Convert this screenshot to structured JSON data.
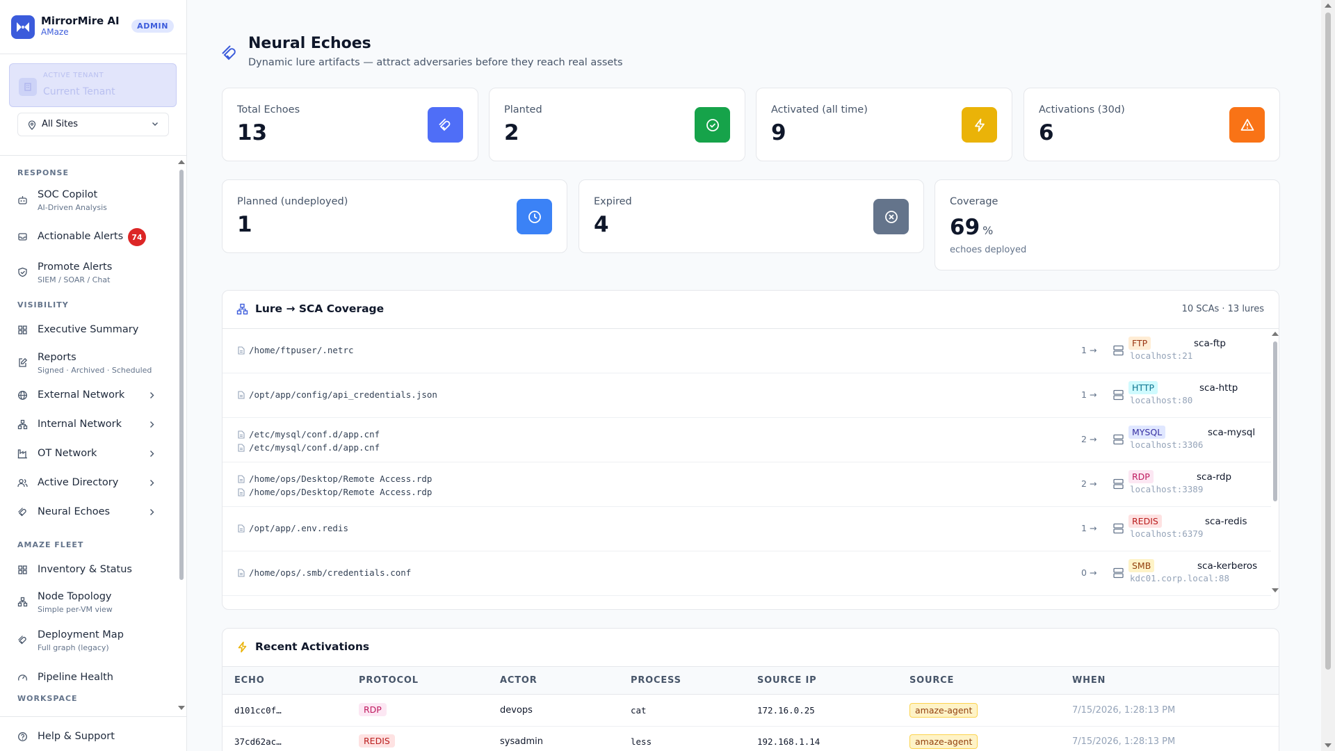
{
  "brand": {
    "name": "MirrorMire AI",
    "sub": "AMaze",
    "badge": "ADMIN"
  },
  "tenant": {
    "label": "ACTIVE TENANT",
    "name": "Current Tenant"
  },
  "site_select": {
    "value": "All Sites"
  },
  "nav": {
    "sections": {
      "response": "RESPONSE",
      "visibility": "VISIBILITY",
      "fleet": "AMAZE FLEET",
      "workspace": "WORKSPACE"
    },
    "soc_copilot": {
      "label": "SOC Copilot",
      "sub": "AI-Driven Analysis"
    },
    "actionable_alerts": {
      "label": "Actionable Alerts",
      "badge": "74"
    },
    "promote_alerts": {
      "label": "Promote Alerts",
      "sub": "SIEM / SOAR / Chat"
    },
    "executive_summary": {
      "label": "Executive Summary"
    },
    "reports": {
      "label": "Reports",
      "sub": "Signed · Archived · Scheduled"
    },
    "external_network": {
      "label": "External Network"
    },
    "internal_network": {
      "label": "Internal Network"
    },
    "ot_network": {
      "label": "OT Network"
    },
    "active_directory": {
      "label": "Active Directory"
    },
    "neural_echoes": {
      "label": "Neural Echoes"
    },
    "inventory": {
      "label": "Inventory & Status"
    },
    "node_topology": {
      "label": "Node Topology",
      "sub": "Simple per-VM view"
    },
    "deployment_map": {
      "label": "Deployment Map",
      "sub": "Full graph (legacy)"
    },
    "pipeline_health": {
      "label": "Pipeline Health"
    },
    "help": {
      "label": "Help & Support"
    }
  },
  "header": {
    "title": "Neural Echoes",
    "subtitle": "Dynamic lure artifacts — attract adversaries before they reach real assets"
  },
  "stats": {
    "total": {
      "label": "Total Echoes",
      "value": "13",
      "color": "#4f6ef7"
    },
    "planted": {
      "label": "Planted",
      "value": "2",
      "color": "#16a34a"
    },
    "activated": {
      "label": "Activated (all time)",
      "value": "9",
      "color": "#eab308"
    },
    "activations30": {
      "label": "Activations (30d)",
      "value": "6",
      "color": "#f97316"
    },
    "planned": {
      "label": "Planned (undeployed)",
      "value": "1",
      "color": "#3b82f6"
    },
    "expired": {
      "label": "Expired",
      "value": "4",
      "color": "#64748b"
    },
    "coverage": {
      "label": "Coverage",
      "value": "69",
      "unit": "%",
      "note": "echoes deployed"
    }
  },
  "coverage_panel": {
    "title": "Lure → SCA Coverage",
    "meta": "10 SCAs · 13 lures",
    "rows": [
      {
        "paths": [
          "/home/ftpuser/.netrc"
        ],
        "count": "1 →",
        "protocol": "FTP",
        "sca": "sca-ftp",
        "host": "localhost:21"
      },
      {
        "paths": [
          "/opt/app/config/api_credentials.json"
        ],
        "count": "1 →",
        "protocol": "HTTP",
        "sca": "sca-http",
        "host": "localhost:80"
      },
      {
        "paths": [
          "/etc/mysql/conf.d/app.cnf",
          "/etc/mysql/conf.d/app.cnf"
        ],
        "count": "2 →",
        "protocol": "MYSQL",
        "sca": "sca-mysql",
        "host": "localhost:3306"
      },
      {
        "paths": [
          "/home/ops/Desktop/Remote Access.rdp",
          "/home/ops/Desktop/Remote Access.rdp"
        ],
        "count": "2 →",
        "protocol": "RDP",
        "sca": "sca-rdp",
        "host": "localhost:3389"
      },
      {
        "paths": [
          "/opt/app/.env.redis"
        ],
        "count": "1 →",
        "protocol": "REDIS",
        "sca": "sca-redis",
        "host": "localhost:6379"
      },
      {
        "paths": [
          "/home/ops/.smb/credentials.conf"
        ],
        "count": "0 →",
        "protocol": "SMB",
        "sca": "sca-kerberos",
        "host": "kdc01.corp.local:88"
      }
    ]
  },
  "activations": {
    "title": "Recent Activations",
    "columns": {
      "echo": "ECHO",
      "protocol": "PROTOCOL",
      "actor": "ACTOR",
      "process": "PROCESS",
      "source_ip": "SOURCE IP",
      "source": "SOURCE",
      "when": "WHEN"
    },
    "rows": [
      {
        "echo": "d101cc0f…",
        "protocol": "RDP",
        "actor": "devops",
        "process": "cat",
        "source_ip": "172.16.0.25",
        "source": "amaze-agent",
        "when": "7/15/2026, 1:28:13 PM"
      },
      {
        "echo": "37cd62ac…",
        "protocol": "REDIS",
        "actor": "sysadmin",
        "process": "less",
        "source_ip": "192.168.1.14",
        "source": "amaze-agent",
        "when": "7/15/2026, 1:28:13 PM"
      }
    ]
  }
}
